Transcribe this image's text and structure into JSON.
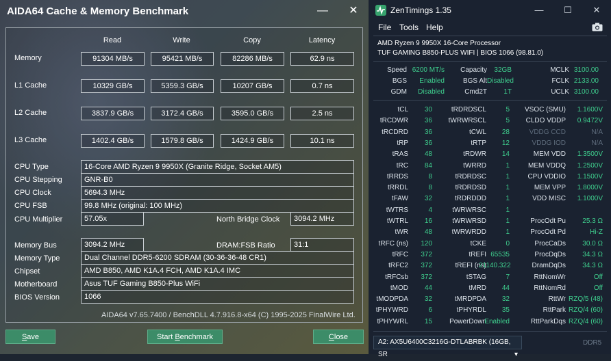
{
  "aida": {
    "title": "AIDA64 Cache & Memory Benchmark",
    "headers": [
      "Read",
      "Write",
      "Copy",
      "Latency"
    ],
    "rows": [
      {
        "label": "Memory",
        "read": "91304 MB/s",
        "write": "95421 MB/s",
        "copy": "82286 MB/s",
        "latency": "62.9 ns"
      },
      {
        "label": "L1 Cache",
        "read": "10329 GB/s",
        "write": "5359.3 GB/s",
        "copy": "10207 GB/s",
        "latency": "0.7 ns"
      },
      {
        "label": "L2 Cache",
        "read": "3837.9 GB/s",
        "write": "3172.4 GB/s",
        "copy": "3595.0 GB/s",
        "latency": "2.5 ns"
      },
      {
        "label": "L3 Cache",
        "read": "1402.4 GB/s",
        "write": "1579.8 GB/s",
        "copy": "1424.9 GB/s",
        "latency": "10.1 ns"
      }
    ],
    "info": {
      "cpu_type_label": "CPU Type",
      "cpu_type": "16-Core AMD Ryzen 9 9950X  (Granite Ridge, Socket AM5)",
      "cpu_stepping_label": "CPU Stepping",
      "cpu_stepping": "GNR-B0",
      "cpu_clock_label": "CPU Clock",
      "cpu_clock": "5694.3 MHz",
      "cpu_fsb_label": "CPU FSB",
      "cpu_fsb": "99.8 MHz  (original: 100 MHz)",
      "cpu_multiplier_label": "CPU Multiplier",
      "cpu_multiplier": "57.05x",
      "nb_clock_label": "North Bridge Clock",
      "nb_clock": "3094.2 MHz",
      "memory_bus_label": "Memory Bus",
      "memory_bus": "3094.2 MHz",
      "dram_fsb_label": "DRAM:FSB Ratio",
      "dram_fsb": "31:1",
      "memory_type_label": "Memory Type",
      "memory_type": "Dual Channel DDR5-6200 SDRAM  (30-36-36-48 CR1)",
      "chipset_label": "Chipset",
      "chipset": "AMD B850, AMD K1A.4 FCH, AMD K1A.4 IMC",
      "motherboard_label": "Motherboard",
      "motherboard": "Asus TUF Gaming B850-Plus WiFi",
      "bios_label": "BIOS Version",
      "bios": "1066"
    },
    "footer": "AIDA64 v7.65.7400 / BenchDLL 4.7.916.8-x64  (C) 1995-2025 FinalWire Ltd.",
    "buttons": {
      "save_pre": "",
      "save_ul": "S",
      "save_post": "ave",
      "start_pre": "Start ",
      "start_ul": "B",
      "start_post": "enchmark",
      "close_pre": "",
      "close_ul": "C",
      "close_post": "lose"
    },
    "minimize": "—",
    "close_x": "✕"
  },
  "zen": {
    "title": "ZenTimings 1.35",
    "menu": [
      "File",
      "Tools",
      "Help"
    ],
    "cpu": "AMD Ryzen 9 9950X 16-Core Processor",
    "board": "TUF GAMING B850-PLUS WIFI | BIOS 1066 (98.81.0)",
    "top": [
      [
        "Speed",
        "6200 MT/s",
        "Capacity",
        "32GB",
        "MCLK",
        "3100.00"
      ],
      [
        "BGS",
        "Enabled",
        "BGS Alt",
        "Disabled",
        "FCLK",
        "2133.00"
      ],
      [
        "GDM",
        "Disabled",
        "Cmd2T",
        "1T",
        "UCLK",
        "3100.00"
      ]
    ],
    "timings": [
      [
        "tCL",
        "30",
        "tRDRDSCL",
        "5",
        "VSOC (SMU)",
        "1.1600V",
        0
      ],
      [
        "tRCDWR",
        "36",
        "tWRWRSCL",
        "5",
        "CLDO VDDP",
        "0.9472V",
        0
      ],
      [
        "tRCDRD",
        "36",
        "tCWL",
        "28",
        "VDDG CCD",
        "N/A",
        1
      ],
      [
        "tRP",
        "36",
        "tRTP",
        "12",
        "VDDG IOD",
        "N/A",
        1
      ],
      [
        "tRAS",
        "48",
        "tRDWR",
        "14",
        "MEM VDD",
        "1.3500V",
        0
      ],
      [
        "tRC",
        "84",
        "tWRRD",
        "1",
        "MEM VDDQ",
        "1.2500V",
        0
      ],
      [
        "tRRDS",
        "8",
        "tRDRDSC",
        "1",
        "CPU VDDIO",
        "1.1500V",
        0
      ],
      [
        "tRRDL",
        "8",
        "tRDRDSD",
        "1",
        "MEM VPP",
        "1.8000V",
        0
      ],
      [
        "tFAW",
        "32",
        "tRDRDDD",
        "1",
        "VDD MISC",
        "1.1000V",
        0
      ],
      [
        "tWTRS",
        "4",
        "tWRWRSC",
        "1",
        "",
        "",
        0
      ],
      [
        "tWTRL",
        "16",
        "tWRWRSD",
        "1",
        "ProcOdt Pu",
        "25.3 Ω",
        0
      ],
      [
        "tWR",
        "48",
        "tWRWRDD",
        "1",
        "ProcOdt Pd",
        "Hi-Z",
        0
      ],
      [
        "tRFC (ns)",
        "120",
        "tCKE",
        "0",
        "ProcCaDs",
        "30.0 Ω",
        0
      ],
      [
        "tRFC",
        "372",
        "tREFI",
        "65535",
        "ProcDqDs",
        "34.3 Ω",
        0
      ],
      [
        "tRFC2",
        "372",
        "tREFI (ns)",
        "21140.322",
        "DramDqDs",
        "34.3 Ω",
        0
      ],
      [
        "tRFCsb",
        "372",
        "tSTAG",
        "7",
        "RttNomWr",
        "Off",
        0
      ],
      [
        "tMOD",
        "44",
        "tMRD",
        "44",
        "RttNomRd",
        "Off",
        0
      ],
      [
        "tMODPDA",
        "32",
        "tMRDPDA",
        "32",
        "RttWr",
        "RZQ/5 (48)",
        0
      ],
      [
        "tPHYWRD",
        "6",
        "tPHYRDL",
        "35",
        "RttPark",
        "RZQ/4 (60)",
        0
      ],
      [
        "tPHYWRL",
        "15",
        "PowerDown",
        "Enabled",
        "RttParkDqs",
        "RZQ/4 (60)",
        0
      ]
    ],
    "dimm": "A2: AX5U6400C3216G-DTLABRBK (16GB, SR",
    "ddr": "DDR5",
    "min": "—",
    "max": "☐",
    "close": "✕"
  },
  "colors": {
    "green": "#3fcf8e",
    "aida_button": "#3c8c68",
    "zen_bg": "#1a2230"
  }
}
